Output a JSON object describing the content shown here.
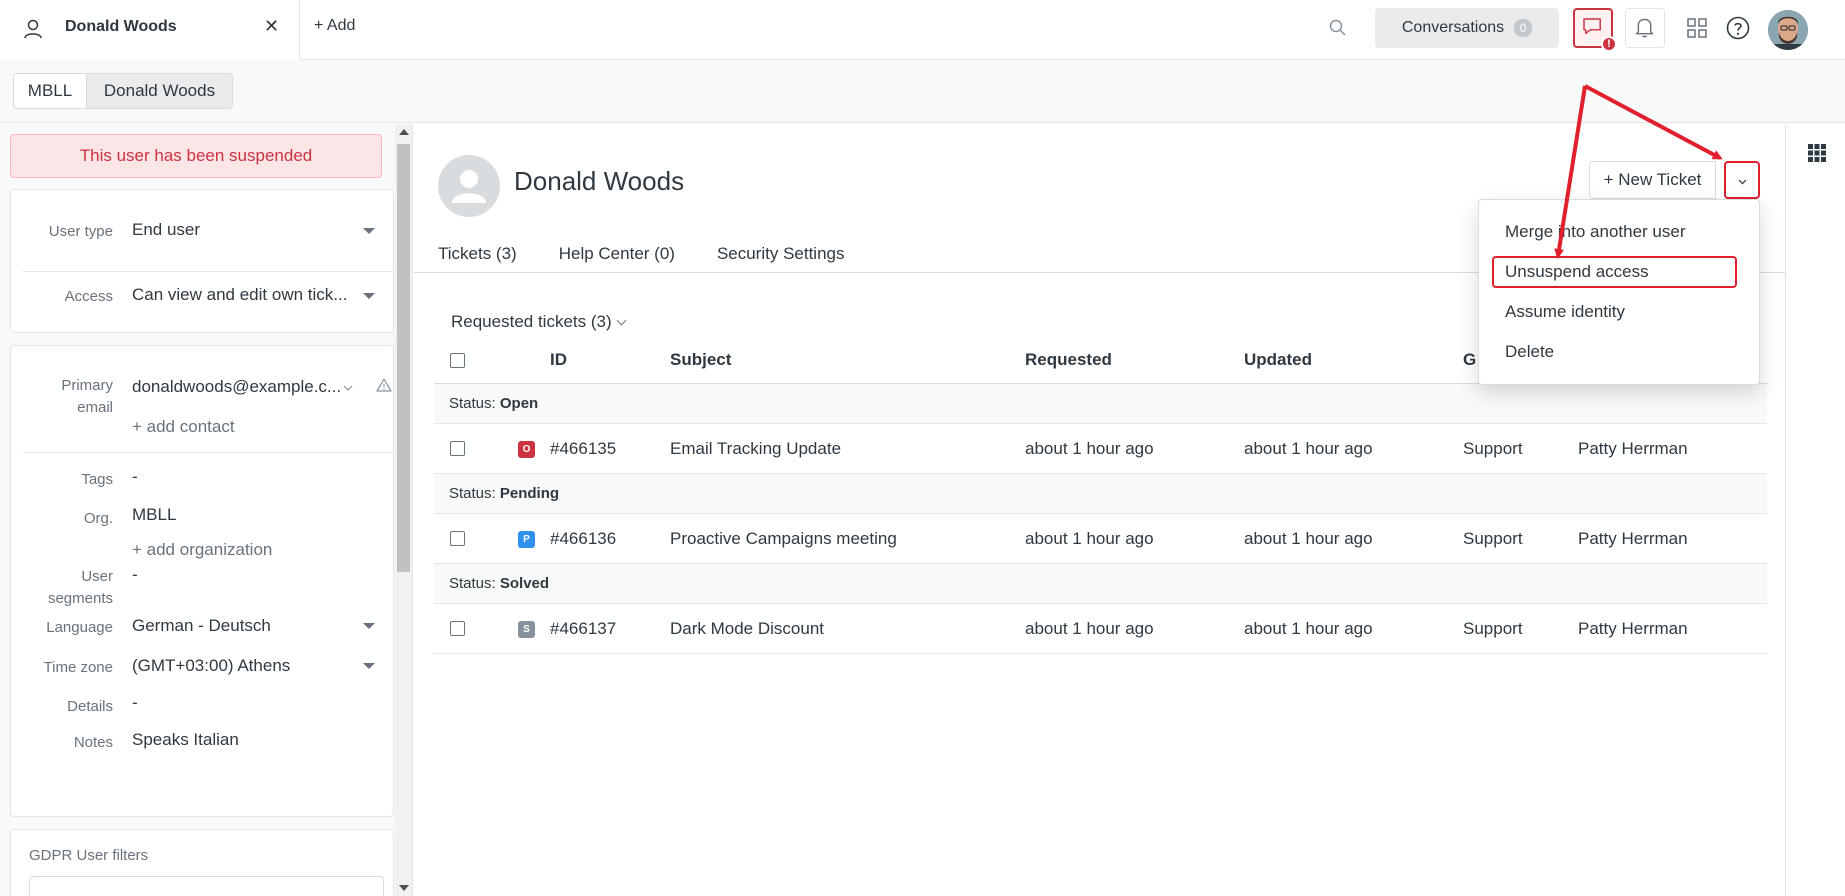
{
  "topbar": {
    "tab_label": "Donald Woods",
    "add_label": "Add",
    "conversations_label": "Conversations",
    "conversations_count": "0",
    "chat_badge": "!"
  },
  "breadcrumb": {
    "org": "MBLL",
    "user": "Donald Woods"
  },
  "sidebar": {
    "suspended_notice": "This user has been suspended",
    "fields": {
      "user_type_label": "User type",
      "user_type_value": "End user",
      "access_label": "Access",
      "access_value": "Can view and edit own tick...",
      "primary_label_1": "Primary",
      "primary_label_2": "email",
      "primary_value": "donaldwoods@example.c...",
      "add_contact": "+ add contact",
      "tags_label": "Tags",
      "tags_value": "-",
      "org_label": "Org.",
      "org_value": "MBLL",
      "add_org": "+ add organization",
      "segments_label_1": "User",
      "segments_label_2": "segments",
      "segments_value": "-",
      "language_label": "Language",
      "language_value": "German - Deutsch",
      "timezone_label": "Time zone",
      "timezone_value": "(GMT+03:00) Athens",
      "details_label": "Details",
      "details_value": "-",
      "notes_label": "Notes",
      "notes_value": "Speaks Italian"
    },
    "gdpr_label": "GDPR User filters"
  },
  "main": {
    "user_name": "Donald Woods",
    "new_ticket_label": "+ New Ticket",
    "tabs": [
      {
        "label": "Tickets (3)"
      },
      {
        "label": "Help Center (0)"
      },
      {
        "label": "Security Settings"
      }
    ],
    "requested_title": "Requested tickets (3)",
    "columns": {
      "id": "ID",
      "subject": "Subject",
      "requested": "Requested",
      "updated": "Updated",
      "group": "G"
    },
    "groups": [
      {
        "status_prefix": "Status: ",
        "status": "Open",
        "pill": "O",
        "pill_color": "#cc3340",
        "ticket": {
          "id": "#466135",
          "subject": "Email Tracking Update",
          "requested": "about 1 hour ago",
          "updated": "about 1 hour ago",
          "group": "Support",
          "assignee": "Patty Herrman"
        }
      },
      {
        "status_prefix": "Status: ",
        "status": "Pending",
        "pill": "P",
        "pill_color": "#3091ec",
        "ticket": {
          "id": "#466136",
          "subject": "Proactive Campaigns meeting",
          "requested": "about 1 hour ago",
          "updated": "about 1 hour ago",
          "group": "Support",
          "assignee": "Patty Herrman"
        }
      },
      {
        "status_prefix": "Status: ",
        "status": "Solved",
        "pill": "S",
        "pill_color": "#87929d",
        "ticket": {
          "id": "#466137",
          "subject": "Dark Mode Discount",
          "requested": "about 1 hour ago",
          "updated": "about 1 hour ago",
          "group": "Support",
          "assignee": "Patty Herrman"
        }
      }
    ]
  },
  "menu": {
    "items": [
      {
        "label": "Merge into another user"
      },
      {
        "label": "Unsuspend access"
      },
      {
        "label": "Assume identity"
      },
      {
        "label": "Delete"
      }
    ]
  },
  "colors": {
    "accent_red": "#e0202d",
    "suspended_bg": "#fbe5e7"
  }
}
